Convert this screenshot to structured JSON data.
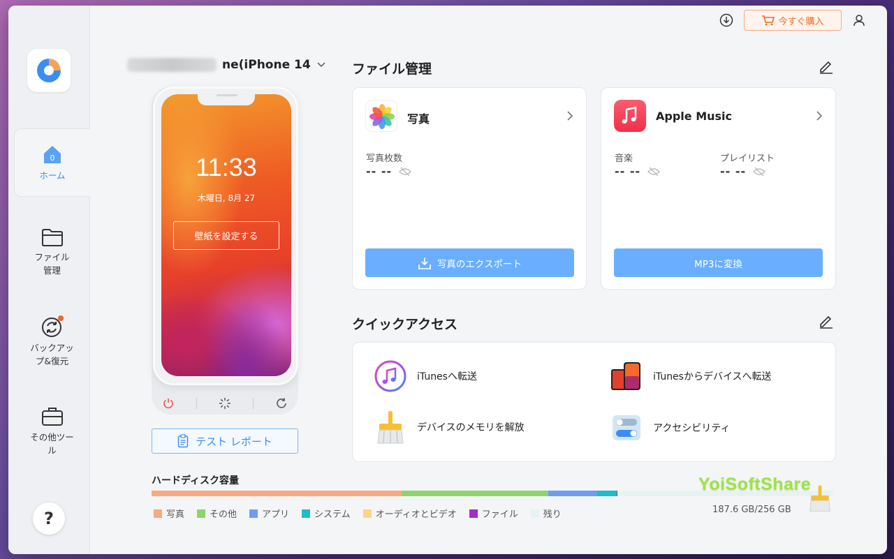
{
  "sidebar": {
    "items": [
      {
        "label": "ホーム",
        "icon": "home-icon",
        "badge": "0"
      },
      {
        "label_lines": [
          "ファイル",
          "管理"
        ],
        "icon": "folder-icon"
      },
      {
        "label_lines": [
          "バックアッ",
          "プ&復元"
        ],
        "icon": "backup-restore-icon"
      },
      {
        "label_lines": [
          "その他ツー",
          "ル"
        ],
        "icon": "toolbox-icon"
      }
    ],
    "help_label": "?"
  },
  "topbar": {
    "buy_label": "今すぐ購入"
  },
  "device": {
    "name": "ne(iPhone 14",
    "time": "11:33",
    "date": "木曜日, 8月 27",
    "wallpaper_button": "壁紙を設定する",
    "report_button": "テスト レポート"
  },
  "file_management": {
    "title": "ファイル管理",
    "photos": {
      "title": "写真",
      "stat_label": "写真枚数",
      "stat_value": "-- --",
      "button": "写真のエクスポート"
    },
    "music": {
      "title": "Apple Music",
      "stats": [
        {
          "label": "音楽",
          "value": "-- --"
        },
        {
          "label": "プレイリスト",
          "value": "-- --"
        }
      ],
      "button": "MP3に変換"
    }
  },
  "quick_access": {
    "title": "クイックアクセス",
    "items": [
      {
        "label": "iTunesへ転送",
        "icon": "itunes-icon"
      },
      {
        "label": "iTunesからデバイスへ転送",
        "icon": "device-transfer-icon"
      },
      {
        "label": "デバイスのメモリを解放",
        "icon": "broom-icon"
      },
      {
        "label": "アクセシビリティ",
        "icon": "toggle-icon"
      }
    ]
  },
  "storage": {
    "title": "ハードディスク容量",
    "size": "187.6 GB/256 GB",
    "legend": [
      {
        "label": "写真",
        "color": "#f9a882"
      },
      {
        "label": "その他",
        "color": "#8fd46a"
      },
      {
        "label": "アプリ",
        "color": "#6f9cf0"
      },
      {
        "label": "システム",
        "color": "#1fbcc9"
      },
      {
        "label": "オーディオとビデオ",
        "color": "#fdd48a"
      },
      {
        "label": "ファイル",
        "color": "#a12fc9"
      },
      {
        "label": "残り",
        "color": "#e7f3f1"
      }
    ],
    "segments": [
      {
        "name": "写真",
        "fraction": 0.367
      },
      {
        "name": "その他",
        "fraction": 0.216
      },
      {
        "name": "アプリ",
        "fraction": 0.071
      },
      {
        "name": "システム",
        "fraction": 0.029
      },
      {
        "name": "オーディオとビデオ",
        "fraction": 0.0
      },
      {
        "name": "ファイル",
        "fraction": 0.001
      },
      {
        "name": "残り",
        "fraction": 0.316
      }
    ]
  },
  "watermark": "YoiSoftShare"
}
